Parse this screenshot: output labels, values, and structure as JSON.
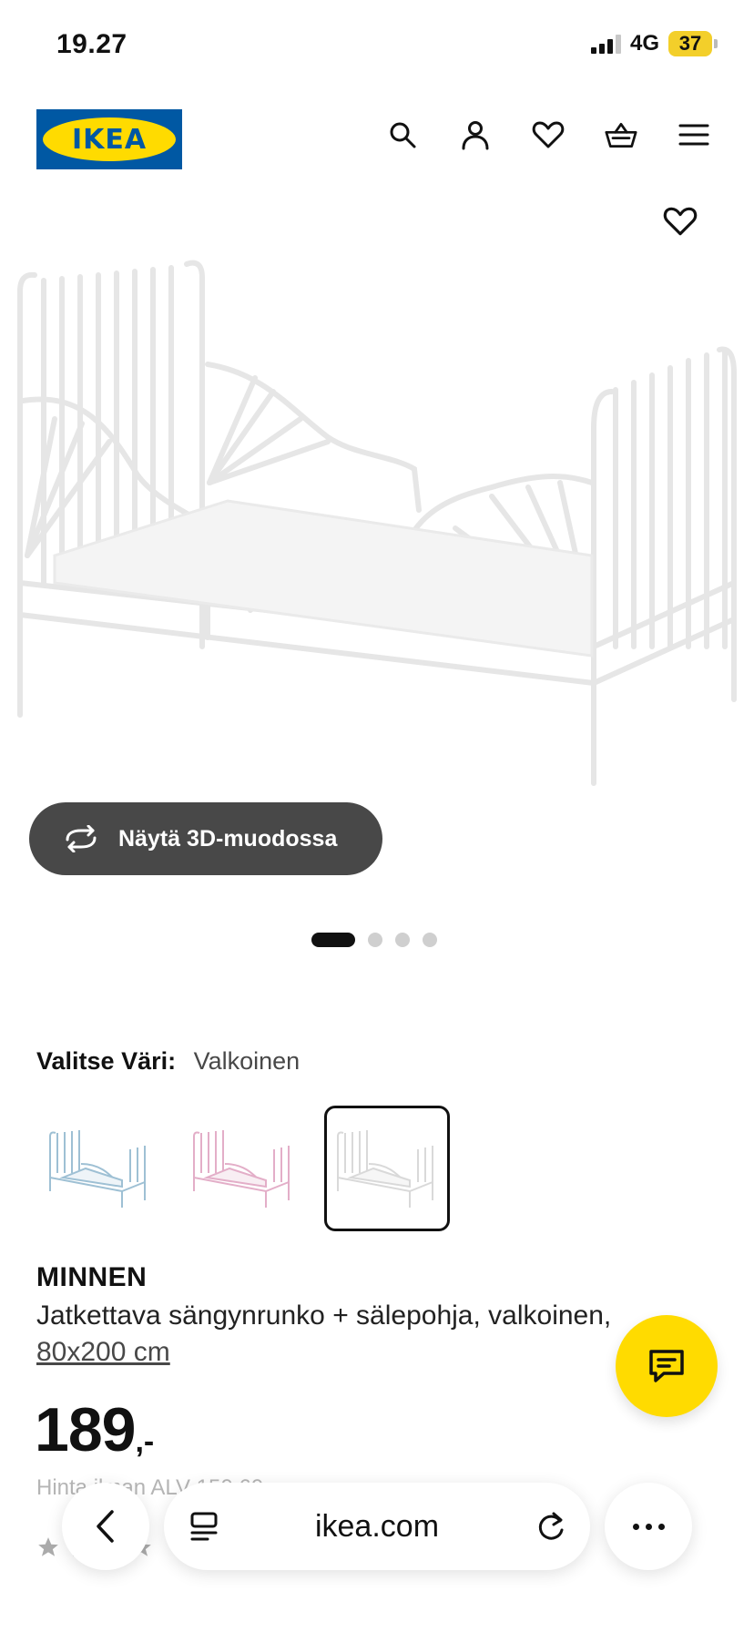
{
  "status": {
    "time": "19.27",
    "network": "4G",
    "battery": "37"
  },
  "header": {
    "logo_text": "IKEA",
    "icons": [
      "search-icon",
      "user-icon",
      "heart-icon",
      "basket-icon",
      "menu-icon"
    ]
  },
  "gallery": {
    "button_3d_label": "Näytä 3D-muodossa",
    "pages": 4,
    "active_page": 1
  },
  "color_select": {
    "label": "Valitse Väri:",
    "value": "Valkoinen",
    "options": [
      "vaaleansininen",
      "vaaleanpunainen",
      "valkoinen"
    ]
  },
  "product": {
    "name": "MINNEN",
    "description": "Jatkettava sängynrunko + sälepohja, valkoinen,",
    "size": "80x200 cm",
    "price_int": "189",
    "price_suffix": ",-",
    "price_vat": "Hinta ilman ALV 150,60"
  },
  "browser": {
    "url": "ikea.com"
  },
  "colors": {
    "brand_blue": "#0058a3",
    "brand_yellow": "#ffdb00",
    "button_dark": "#484848"
  }
}
